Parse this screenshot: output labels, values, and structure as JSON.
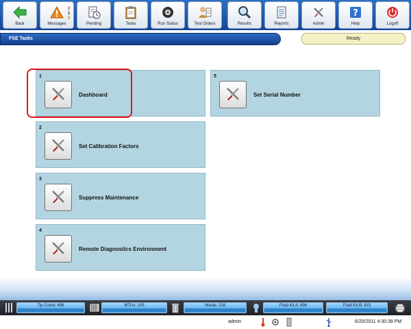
{
  "toolbar": {
    "buttons": [
      {
        "label": "Back",
        "icon": "back-arrow-icon"
      },
      {
        "label": "Messages",
        "icon": "warning-icon"
      },
      {
        "label": "Pending",
        "icon": "pending-icon"
      },
      {
        "label": "Tasks",
        "icon": "clipboard-icon"
      },
      {
        "label": "Run Status",
        "icon": "disc-icon"
      },
      {
        "label": "Test Orders",
        "icon": "test-orders-icon"
      },
      {
        "label": "Results",
        "icon": "magnifier-icon"
      },
      {
        "label": "Reports",
        "icon": "report-icon"
      },
      {
        "label": "Admin",
        "icon": "tools-icon"
      },
      {
        "label": "Help",
        "icon": "help-icon"
      },
      {
        "label": "Logoff",
        "icon": "power-icon"
      }
    ],
    "message_counts": [
      "2",
      "1",
      "5"
    ]
  },
  "title": "FSE Tasks",
  "status": "Ready",
  "tasks": [
    {
      "number": "1",
      "label": "Dashboard"
    },
    {
      "number": "2",
      "label": "Set Calibration Factors"
    },
    {
      "number": "3",
      "label": "Suppress Maintenance"
    },
    {
      "number": "4",
      "label": "Remote Diagnostics Environment"
    },
    {
      "number": "5",
      "label": "Set Serial Number"
    }
  ],
  "gauges": [
    {
      "label": "Tip Count: 496"
    },
    {
      "label": "MTUs: 105"
    },
    {
      "label": "Waste: 216"
    },
    {
      "label": "Fluid Kit A: 696"
    },
    {
      "label": "Fluid Kit B: 815"
    }
  ],
  "user": "admin",
  "datetime": "6/20/2011 4:30:38 PM",
  "colors": {
    "toolbar": "#1f5aa8",
    "tile": "#b3d5e1",
    "highlight": "#e01515",
    "status_pill": "#f5f1c6"
  }
}
